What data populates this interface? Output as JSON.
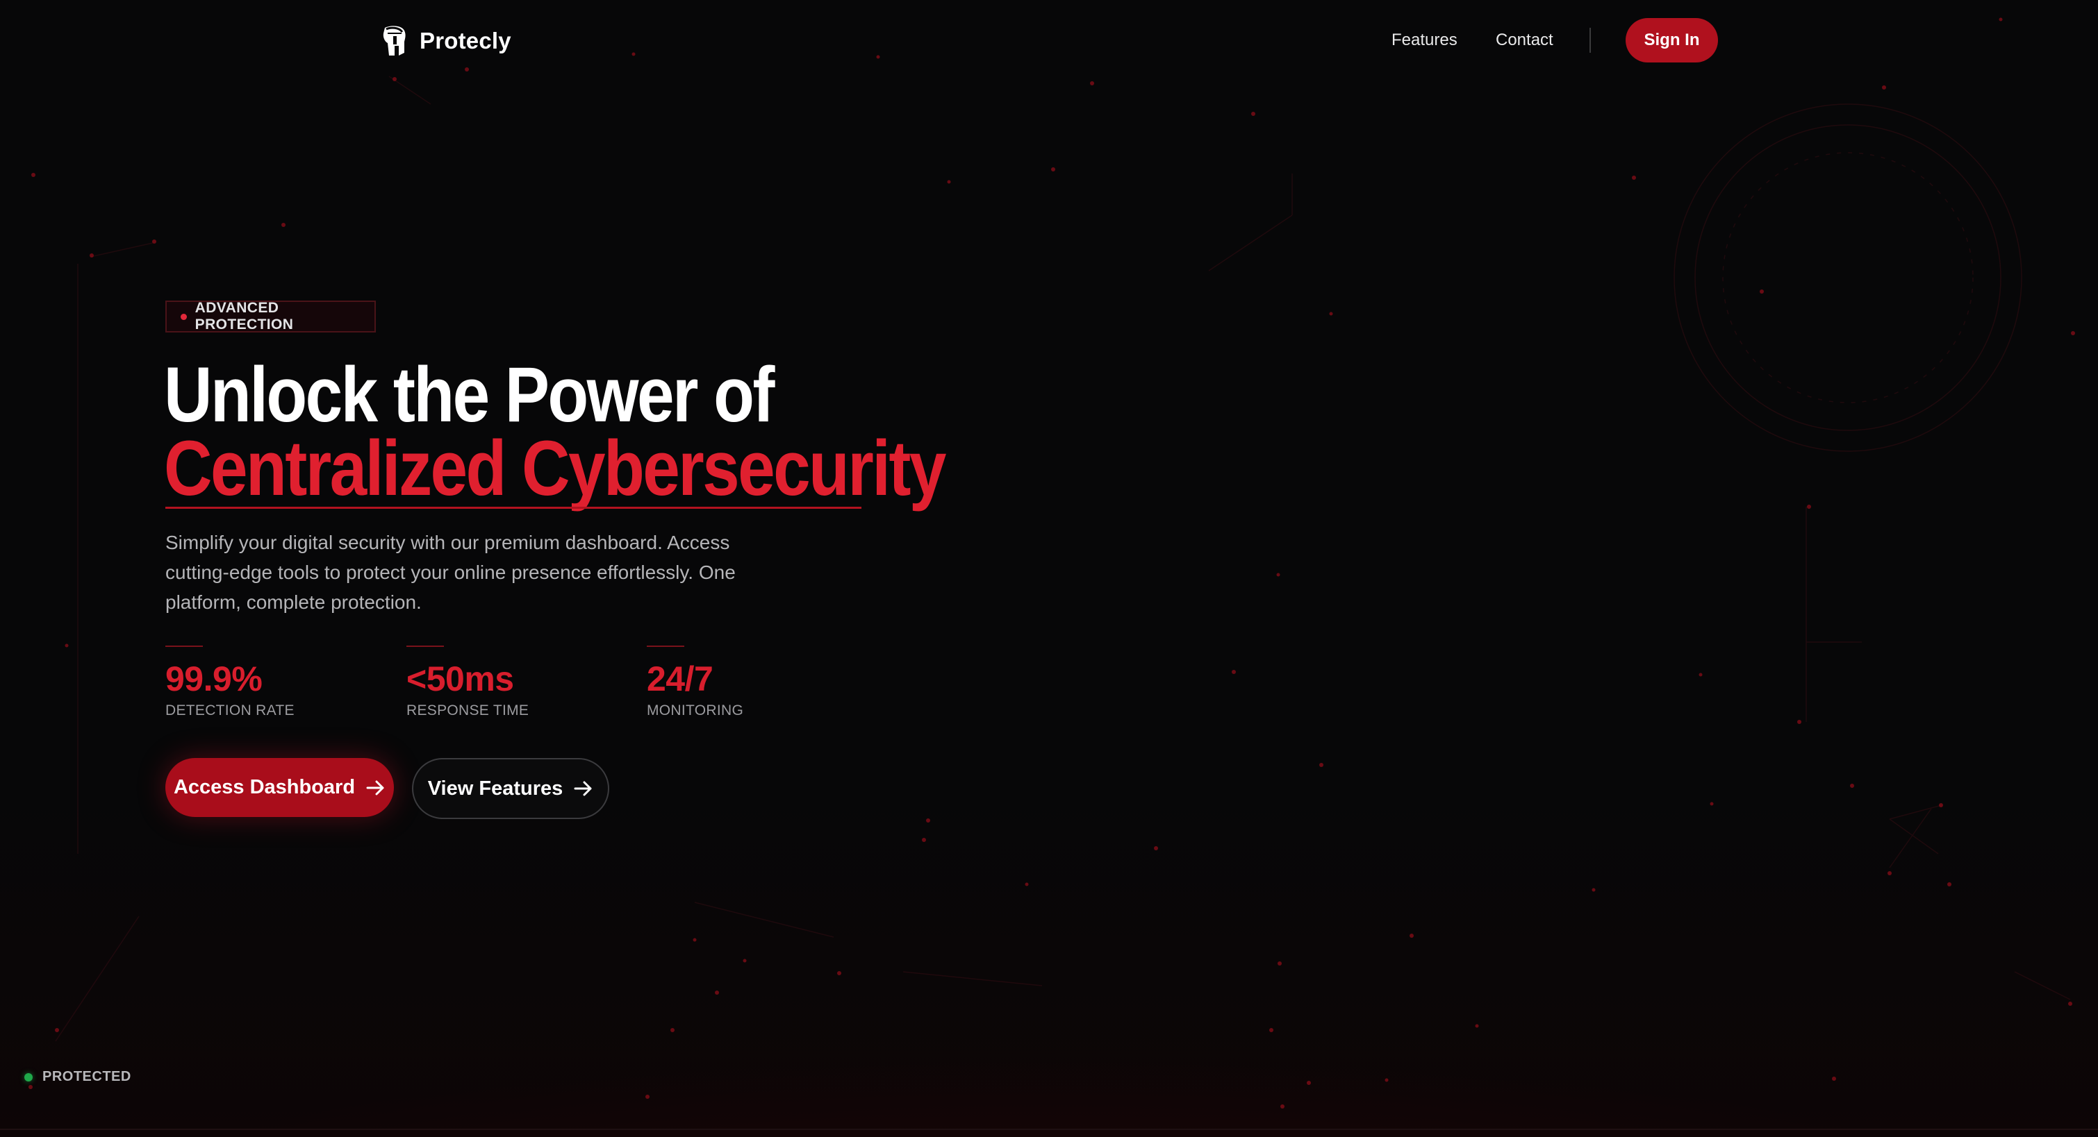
{
  "brand": {
    "name": "Protecly",
    "icon": "spartan-helmet-icon"
  },
  "nav": {
    "links": [
      {
        "label": "Features"
      },
      {
        "label": "Contact"
      }
    ],
    "signin_label": "Sign In"
  },
  "hero": {
    "badge": "ADVANCED PROTECTION",
    "headline_line1": "Unlock the Power of",
    "headline_line2": "Centralized Cybersecurity",
    "subtitle": "Simplify your digital security with our premium dashboard. Access cutting-edge tools to protect your online presence effortlessly. One platform, complete protection.",
    "stats": [
      {
        "value": "99.9%",
        "label": "DETECTION RATE"
      },
      {
        "value": "<50ms",
        "label": "RESPONSE TIME"
      },
      {
        "value": "24/7",
        "label": "MONITORING"
      }
    ],
    "primary_cta": "Access Dashboard",
    "secondary_cta": "View Features"
  },
  "status": {
    "label": "PROTECTED"
  },
  "colors": {
    "background": "#070708",
    "accent": "#b0111e",
    "accent_text": "#e0202f",
    "status_ok": "#1fa84a"
  }
}
